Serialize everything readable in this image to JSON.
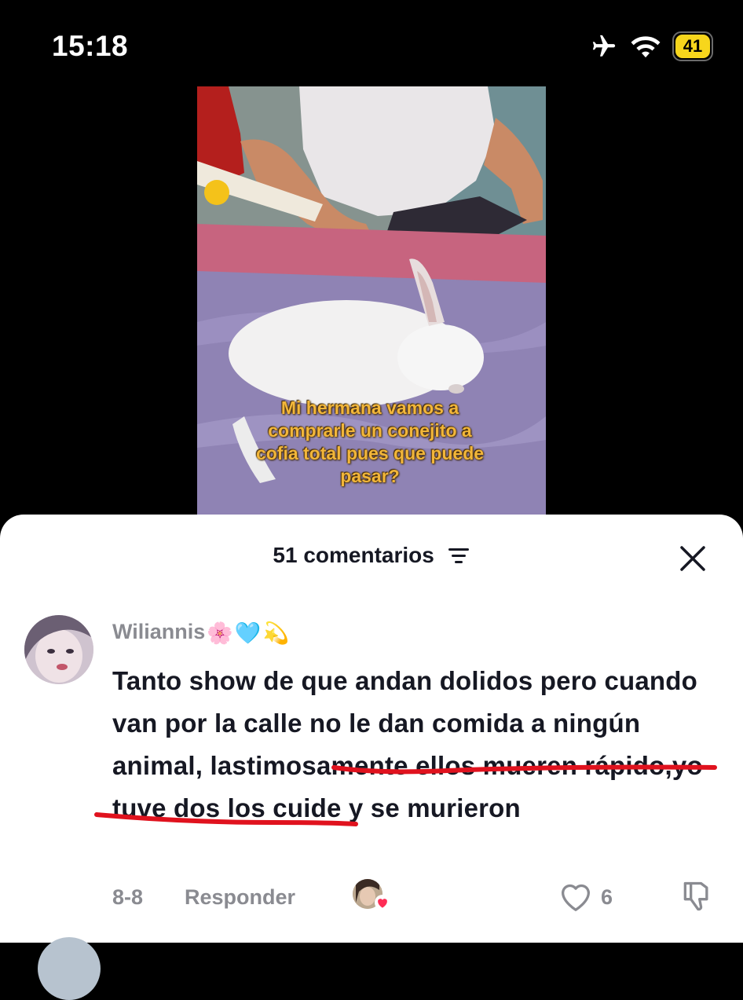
{
  "status_bar": {
    "time": "15:18",
    "battery_level": "41",
    "icons": [
      "airplane-icon",
      "wifi-icon",
      "battery-icon"
    ],
    "battery_color": "#f7d61c"
  },
  "video": {
    "caption_lines": [
      "Mi hermana vamos a",
      "comprarle un conejito a",
      "cofia total pues que puede",
      "pasar?"
    ]
  },
  "comments_sheet": {
    "title": "51 comentarios",
    "comment": {
      "username": "Wiliannis",
      "username_emojis": [
        "🌸",
        "🩵",
        "💫"
      ],
      "text": "Tanto show de que andan dolidos pero cuando van por la calle no le dan comida a ningún animal, lastimosamente ellos mueren rápido,yo tuve dos los cuide y se murieron",
      "date": "8-8",
      "reply_label": "Responder",
      "like_count": "6"
    }
  },
  "colors": {
    "primary_text": "#161823",
    "secondary_text": "#8a8b91",
    "annotation": "#e0121e"
  }
}
